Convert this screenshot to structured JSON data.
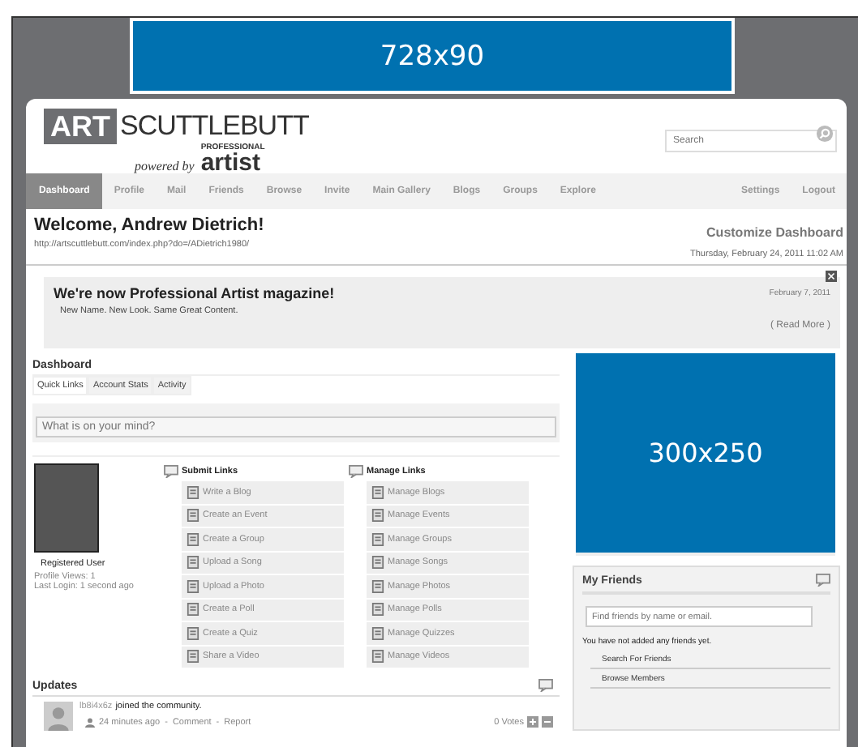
{
  "top_banner": {
    "label": "728x90"
  },
  "logo": {
    "art": "ART",
    "name": "SCUTTLEBUTT",
    "powered_by": "powered by",
    "brand_small": "PROFESSIONAL",
    "brand": "artist"
  },
  "search": {
    "placeholder": "Search"
  },
  "nav": {
    "items": [
      {
        "label": "Dashboard",
        "selected": true
      },
      {
        "label": "Profile",
        "selected": false
      },
      {
        "label": "Mail",
        "selected": false
      },
      {
        "label": "Friends",
        "selected": false
      },
      {
        "label": "Browse",
        "selected": false
      },
      {
        "label": "Invite",
        "selected": false
      },
      {
        "label": "Main Gallery",
        "selected": false
      },
      {
        "label": "Blogs",
        "selected": false
      },
      {
        "label": "Groups",
        "selected": false
      },
      {
        "label": "Explore",
        "selected": false
      }
    ],
    "right_items": [
      {
        "label": "Settings",
        "selected": false
      },
      {
        "label": "Logout",
        "selected": false
      }
    ]
  },
  "welcome": {
    "title": "Welcome, Andrew Dietrich!",
    "url": "http://artscuttlebutt.com/index.php?do=/ADietrich1980/",
    "customize": "Customize Dashboard",
    "datetime": "Thursday, February 24, 2011 11:02 AM"
  },
  "notice": {
    "title": "We're now Professional Artist magazine!",
    "text": "New Name. New Look. Same Great Content.",
    "date": "February 7, 2011",
    "read_more": "( Read More )"
  },
  "dashboard": {
    "title": "Dashboard",
    "tabs": [
      {
        "label": "Quick Links",
        "selected": true
      },
      {
        "label": "Account Stats",
        "selected": false
      },
      {
        "label": "Activity",
        "selected": false
      }
    ],
    "status_placeholder": "What is on your mind?",
    "profile": {
      "role": "Registered User",
      "views": "Profile Views: 1",
      "last_login": "Last Login: 1 second ago"
    },
    "submit_links": {
      "title": "Submit Links",
      "items": [
        "Write a Blog",
        "Create an Event",
        "Create a Group",
        "Upload a Song",
        "Upload a Photo",
        "Create a Poll",
        "Create a Quiz",
        "Share a Video"
      ]
    },
    "manage_links": {
      "title": "Manage Links",
      "items": [
        "Manage Blogs",
        "Manage Events",
        "Manage Groups",
        "Manage Songs",
        "Manage Photos",
        "Manage Polls",
        "Manage Quizzes",
        "Manage Videos"
      ]
    }
  },
  "updates": {
    "title": "Updates",
    "items": [
      {
        "user": "lb8i4x6z",
        "action": "joined the community.",
        "time": "24 minutes ago",
        "separator_1": "-",
        "comment": "Comment",
        "separator_2": "-",
        "report": "Report",
        "votes": "0 Votes"
      }
    ]
  },
  "side_ad": {
    "label": "300x250"
  },
  "my_friends": {
    "title": "My Friends",
    "search_placeholder": "Find friends by name or email.",
    "empty_text": "You have not added any friends yet.",
    "links": [
      "Search For Friends",
      "Browse Members"
    ]
  }
}
